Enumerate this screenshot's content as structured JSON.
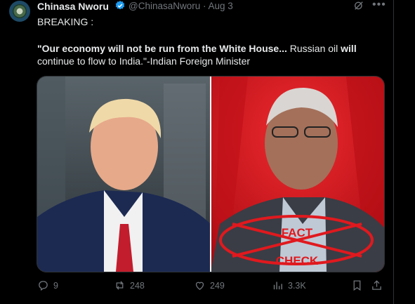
{
  "post": {
    "author_name": "Chinasa Nworu",
    "handle": "@ChinasaNworu",
    "separator": "·",
    "date": "Aug 3",
    "heading": "BREAKING :",
    "quote_bold_1": "\"Our economy will not be run from the White House...",
    "quote_normal_1": " Russian oil ",
    "quote_bold_2": "will",
    "quote_normal_2": "continue to flow to India.\"-Indian Foreign Minister"
  },
  "media": {
    "stamp_line_1": "FACT",
    "stamp_line_2": "CHECK",
    "stamp_color": "#e0191e",
    "left_bg": "#3b4a52",
    "right_bg": "#d7141c"
  },
  "actions": {
    "replies": "9",
    "reposts": "248",
    "likes": "249",
    "views": "3.3K"
  },
  "icons": [
    "verified-icon",
    "grok-icon",
    "more-icon",
    "reply-icon",
    "repost-icon",
    "like-icon",
    "views-icon",
    "bookmark-icon",
    "share-icon"
  ]
}
